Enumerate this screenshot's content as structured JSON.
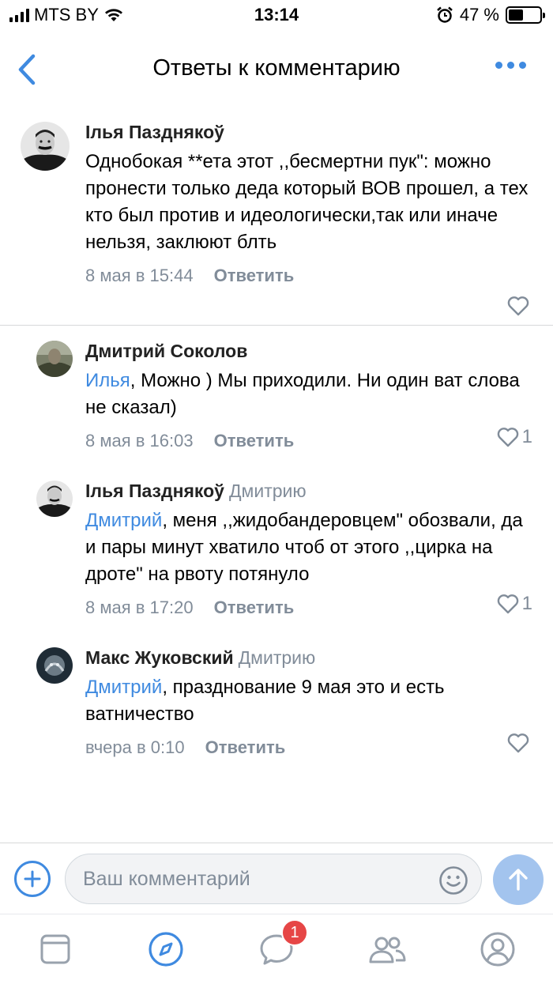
{
  "status_bar": {
    "carrier": "MTS BY",
    "time": "13:14",
    "battery": "47 %",
    "battery_level": 0.47
  },
  "header": {
    "title": "Ответы к комментарию"
  },
  "comments": [
    {
      "author": "Ілья Пазднякоў",
      "reply_to": "",
      "mention": "",
      "text": "Однобокая **ета этот ,,бесмертни пук\": можно пронести только деда который ВОВ прошел, а тех кто был против и идеологически,так или иначе нельзя, заклюют блть",
      "date": "8 мая в 15:44",
      "reply_label": "Ответить",
      "likes": ""
    },
    {
      "author": "Дмитрий Соколов",
      "reply_to": "",
      "mention": "Илья",
      "text": ", Можно ) Мы приходили. Ни один ват слова не сказал)",
      "date": "8 мая в 16:03",
      "reply_label": "Ответить",
      "likes": "1"
    },
    {
      "author": "Ілья Пазднякоў",
      "reply_to": "Дмитрию",
      "mention": "Дмитрий",
      "text": ", меня ,,жидобандеровцем\" обозвали, да и пары минут хватило чтоб от этого ,,цирка на дроте\" на рвоту потянуло",
      "date": "8 мая в 17:20",
      "reply_label": "Ответить",
      "likes": "1"
    },
    {
      "author": "Макс Жуковский",
      "reply_to": "Дмитрию",
      "mention": "Дмитрий",
      "text": ", празднование 9 мая это и есть ватничество",
      "date": "вчера в 0:10",
      "reply_label": "Ответить",
      "likes": ""
    }
  ],
  "input": {
    "placeholder": "Ваш комментарий"
  },
  "tab_bar": {
    "messages_badge": "1"
  },
  "colors": {
    "accent": "#3f8ae0",
    "secondary_text": "#818c99",
    "send_button": "#a3c4ee",
    "badge": "#e64646"
  }
}
